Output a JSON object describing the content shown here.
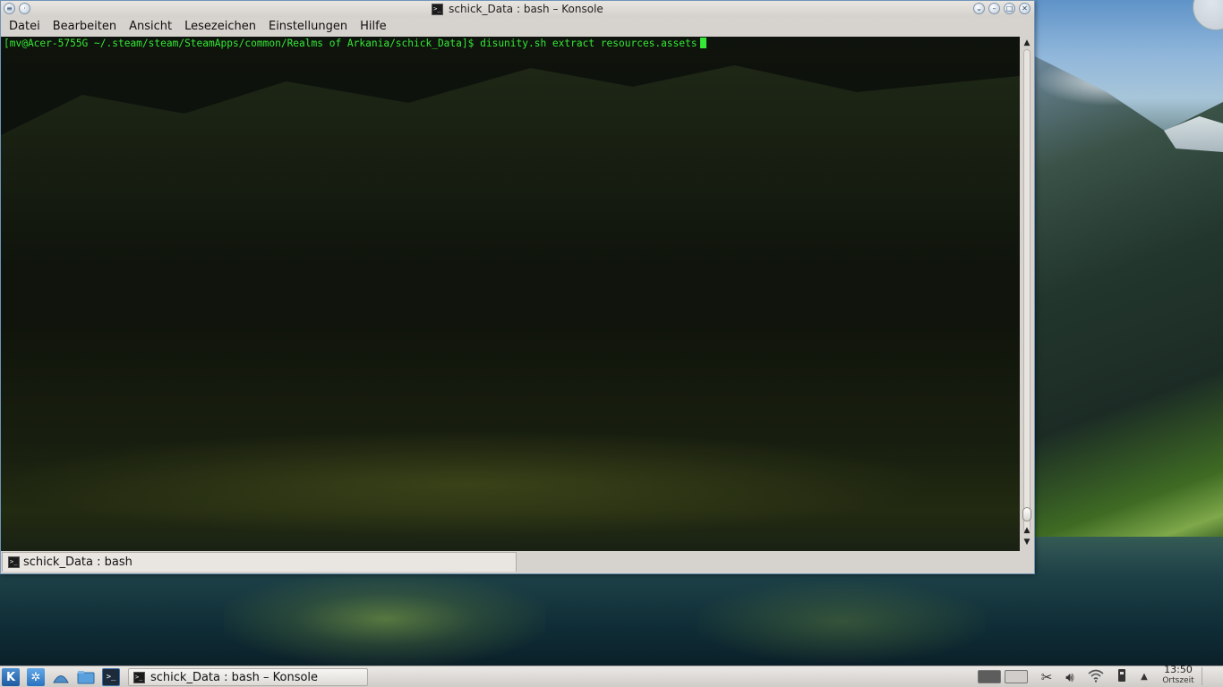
{
  "window": {
    "title": "schick_Data : bash – Konsole"
  },
  "menubar": {
    "items": [
      "Datei",
      "Bearbeiten",
      "Ansicht",
      "Lesezeichen",
      "Einstellungen",
      "Hilfe"
    ]
  },
  "terminal": {
    "prompt": "[mv@Acer-5755G ~/.steam/steam/SteamApps/common/Realms of Arkania/schick_Data]$ ",
    "command": "disunity.sh extract resources.assets",
    "text_color": "#35e835"
  },
  "tabs": [
    {
      "label": "schick_Data : bash"
    }
  ],
  "taskbar": {
    "task_label": "schick_Data : bash – Konsole",
    "clock_time": "13:50",
    "clock_zone": "Ortszeit"
  },
  "icons": {
    "window_menu": "menu-icon",
    "sticky": "pin-icon",
    "keep_above": "keep-above-icon",
    "minimize": "minimize-icon",
    "maximize": "maximize-icon",
    "close": "close-icon",
    "konsole": "terminal-icon"
  }
}
